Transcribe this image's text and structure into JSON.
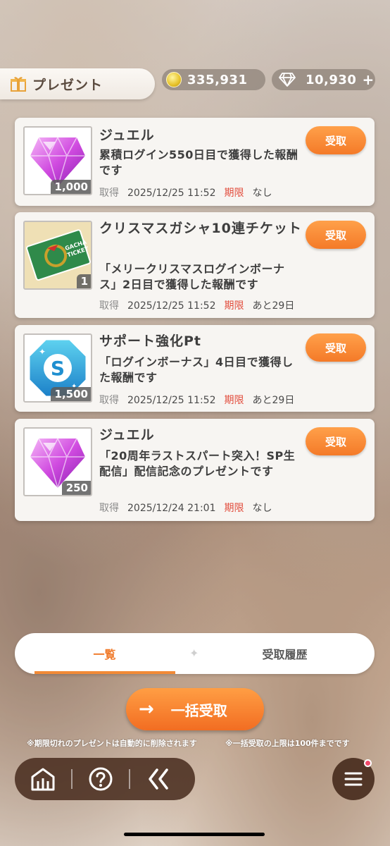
{
  "header": {
    "title": "プレゼント",
    "coins": "335,931",
    "jewels": "10,930",
    "jewel_plus": "+"
  },
  "presents": [
    {
      "name": "ジュエル",
      "desc": "累積ログイン550日目で獲得した報酬です",
      "qty": "1,000",
      "acquired_label": "取得",
      "acquired": "2025/12/25 11:52",
      "expiry_label": "期限",
      "expiry": "なし",
      "button": "受取",
      "icon": "jewel-icon"
    },
    {
      "name": "クリスマスガシャ10連チケット",
      "desc": "「メリークリスマスログインボーナス」2日目で獲得した報酬です",
      "qty": "1",
      "acquired_label": "取得",
      "acquired": "2025/12/25 11:52",
      "expiry_label": "期限",
      "expiry": "あと29日",
      "button": "受取",
      "icon": "gacha-ticket-icon"
    },
    {
      "name": "サポート強化Pt",
      "desc": "「ログインボーナス」4日目で獲得した報酬です",
      "qty": "1,500",
      "acquired_label": "取得",
      "acquired": "2025/12/25 11:52",
      "expiry_label": "期限",
      "expiry": "あと29日",
      "button": "受取",
      "icon": "support-pt-icon"
    },
    {
      "name": "ジュエル",
      "desc": "「20周年ラストスパート突入！SP生配信」配信記念のプレゼントです",
      "qty": "250",
      "acquired_label": "取得",
      "acquired": "2025/12/24 21:01",
      "expiry_label": "期限",
      "expiry": "なし",
      "button": "受取",
      "icon": "jewel-icon"
    }
  ],
  "tabs": {
    "list": "一覧",
    "history": "受取履歴"
  },
  "bulk_button": "一括受取",
  "notes": {
    "left": "※期限切れのプレゼントは自動的に削除されます",
    "right": "※一括受取の上限は100件までです"
  },
  "colors": {
    "accent": "#f47a28",
    "expiry": "#e24b3b"
  }
}
